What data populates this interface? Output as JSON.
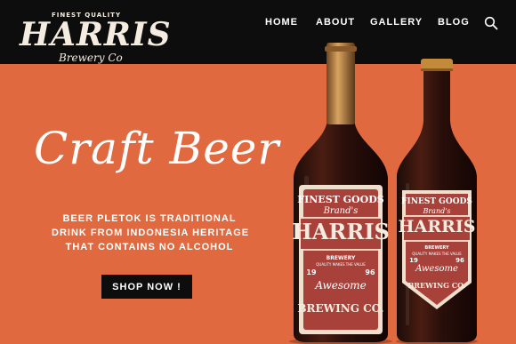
{
  "header": {
    "logo": {
      "tagline": "FINEST QUALITY",
      "name": "HARRIS",
      "sub": "Brewery Co"
    },
    "nav": {
      "home": "HOME",
      "about": "ABOUT",
      "gallery": "GALLERY",
      "blog": "BLOG"
    },
    "search_icon": "search-icon"
  },
  "hero": {
    "headline": "Craft Beer",
    "tagline": [
      "BEER PLETOK IS TRADITIONAL",
      "DRINK FROM INDONESIA HERITAGE",
      "THAT CONTAINS NO ALCOHOL"
    ],
    "cta": "SHOP NOW !"
  },
  "bottle_label": {
    "top": "FINEST GOODS",
    "brand": "Brand's",
    "name": "HARRIS",
    "line1": "BREWERY",
    "line2": "QUALITY MAKES THE VALUE",
    "year_left": "19",
    "year_right": "96",
    "script": "Awesome",
    "bottom": "BREWING CO."
  },
  "colors": {
    "background": "#e0693f",
    "header": "#0d0d0d",
    "label_red": "#a8413a",
    "label_cream": "#eee0cc",
    "foil": "#b9813f"
  }
}
